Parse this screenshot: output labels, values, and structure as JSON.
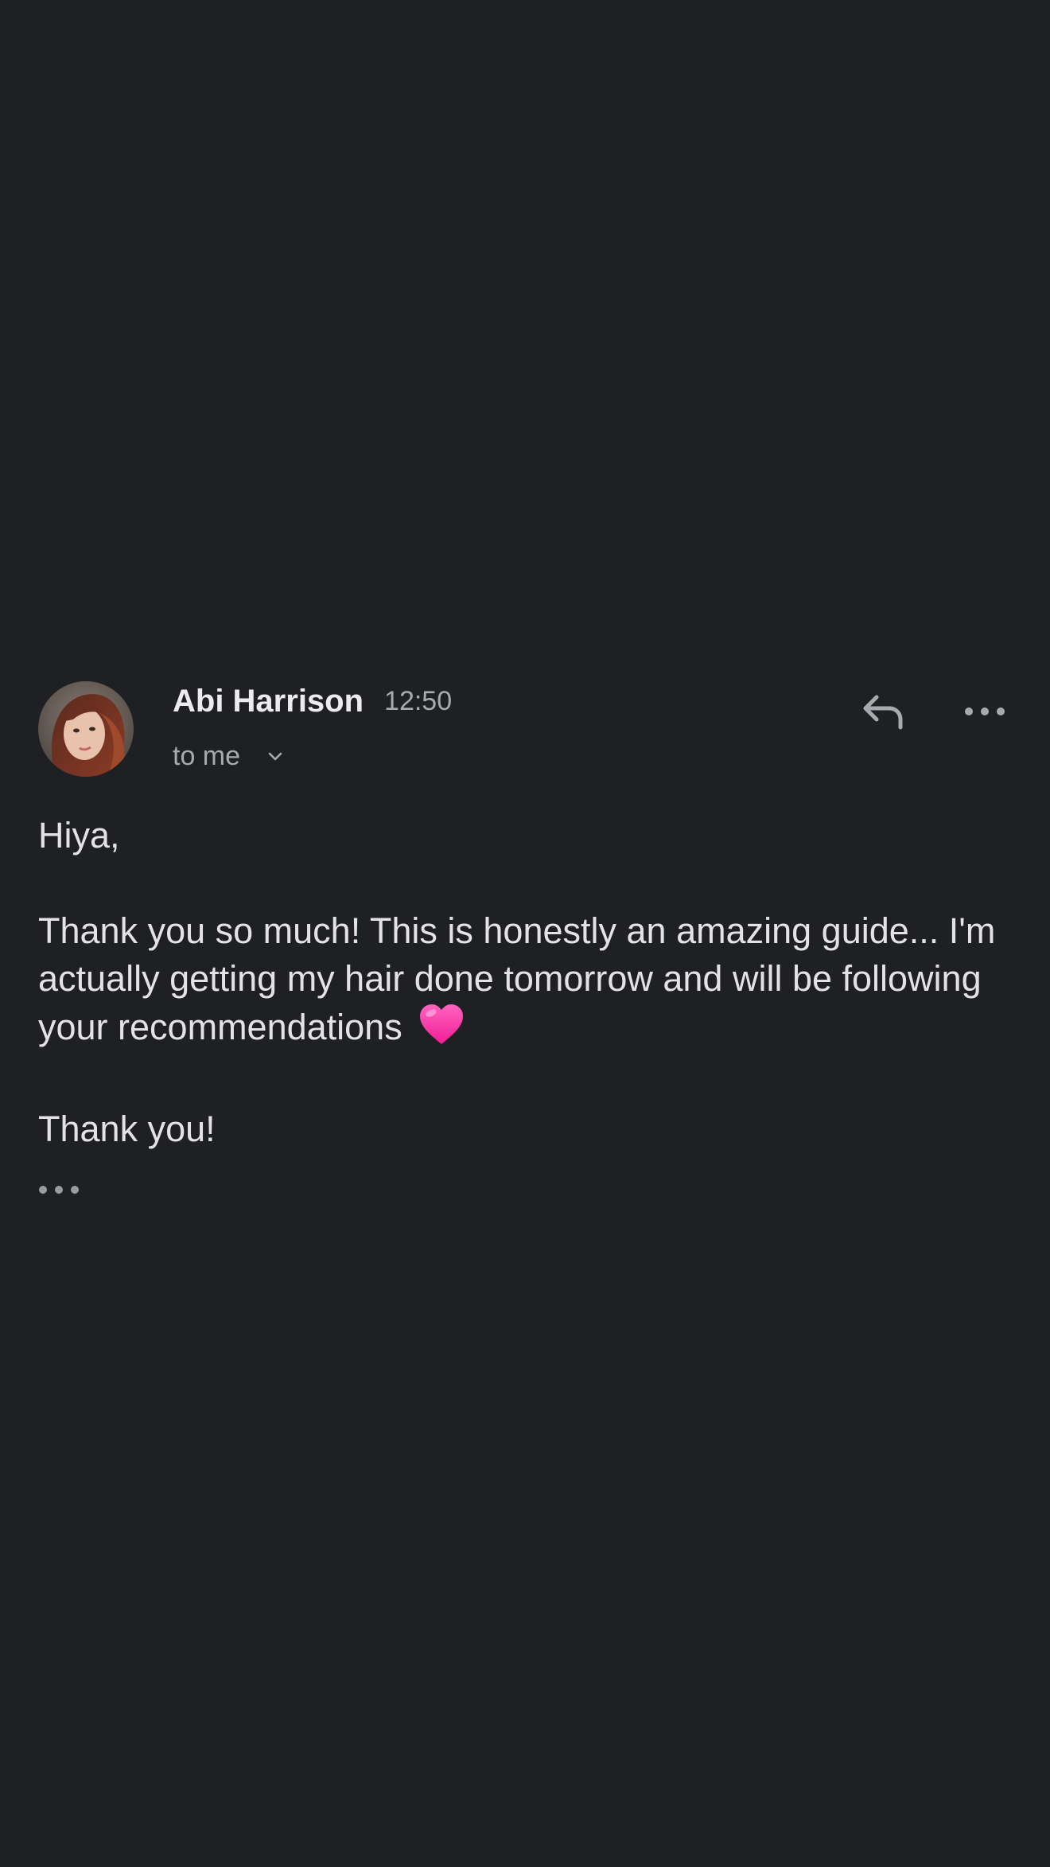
{
  "email": {
    "sender_name": "Abi Harrison",
    "time": "12:50",
    "recipient": "to me",
    "greeting": "Hiya,",
    "body": "Thank you so much! This is honestly an amazing guide... I'm actually getting my hair done tomorrow and will be following your recommendations",
    "closing": "Thank you!"
  },
  "icons": {
    "avatar": "avatar-photo",
    "recipient_toggle": "chevron-down-icon",
    "reply": "reply-icon",
    "more": "more-horizontal-icon",
    "trimmed": "ellipsis-icon",
    "emoji": "pink-heart-emoji"
  },
  "colors": {
    "background": "#1f2023",
    "text": "#e3e3e6",
    "secondary_text": "#a9aab0",
    "heart": "#ff3fae"
  }
}
